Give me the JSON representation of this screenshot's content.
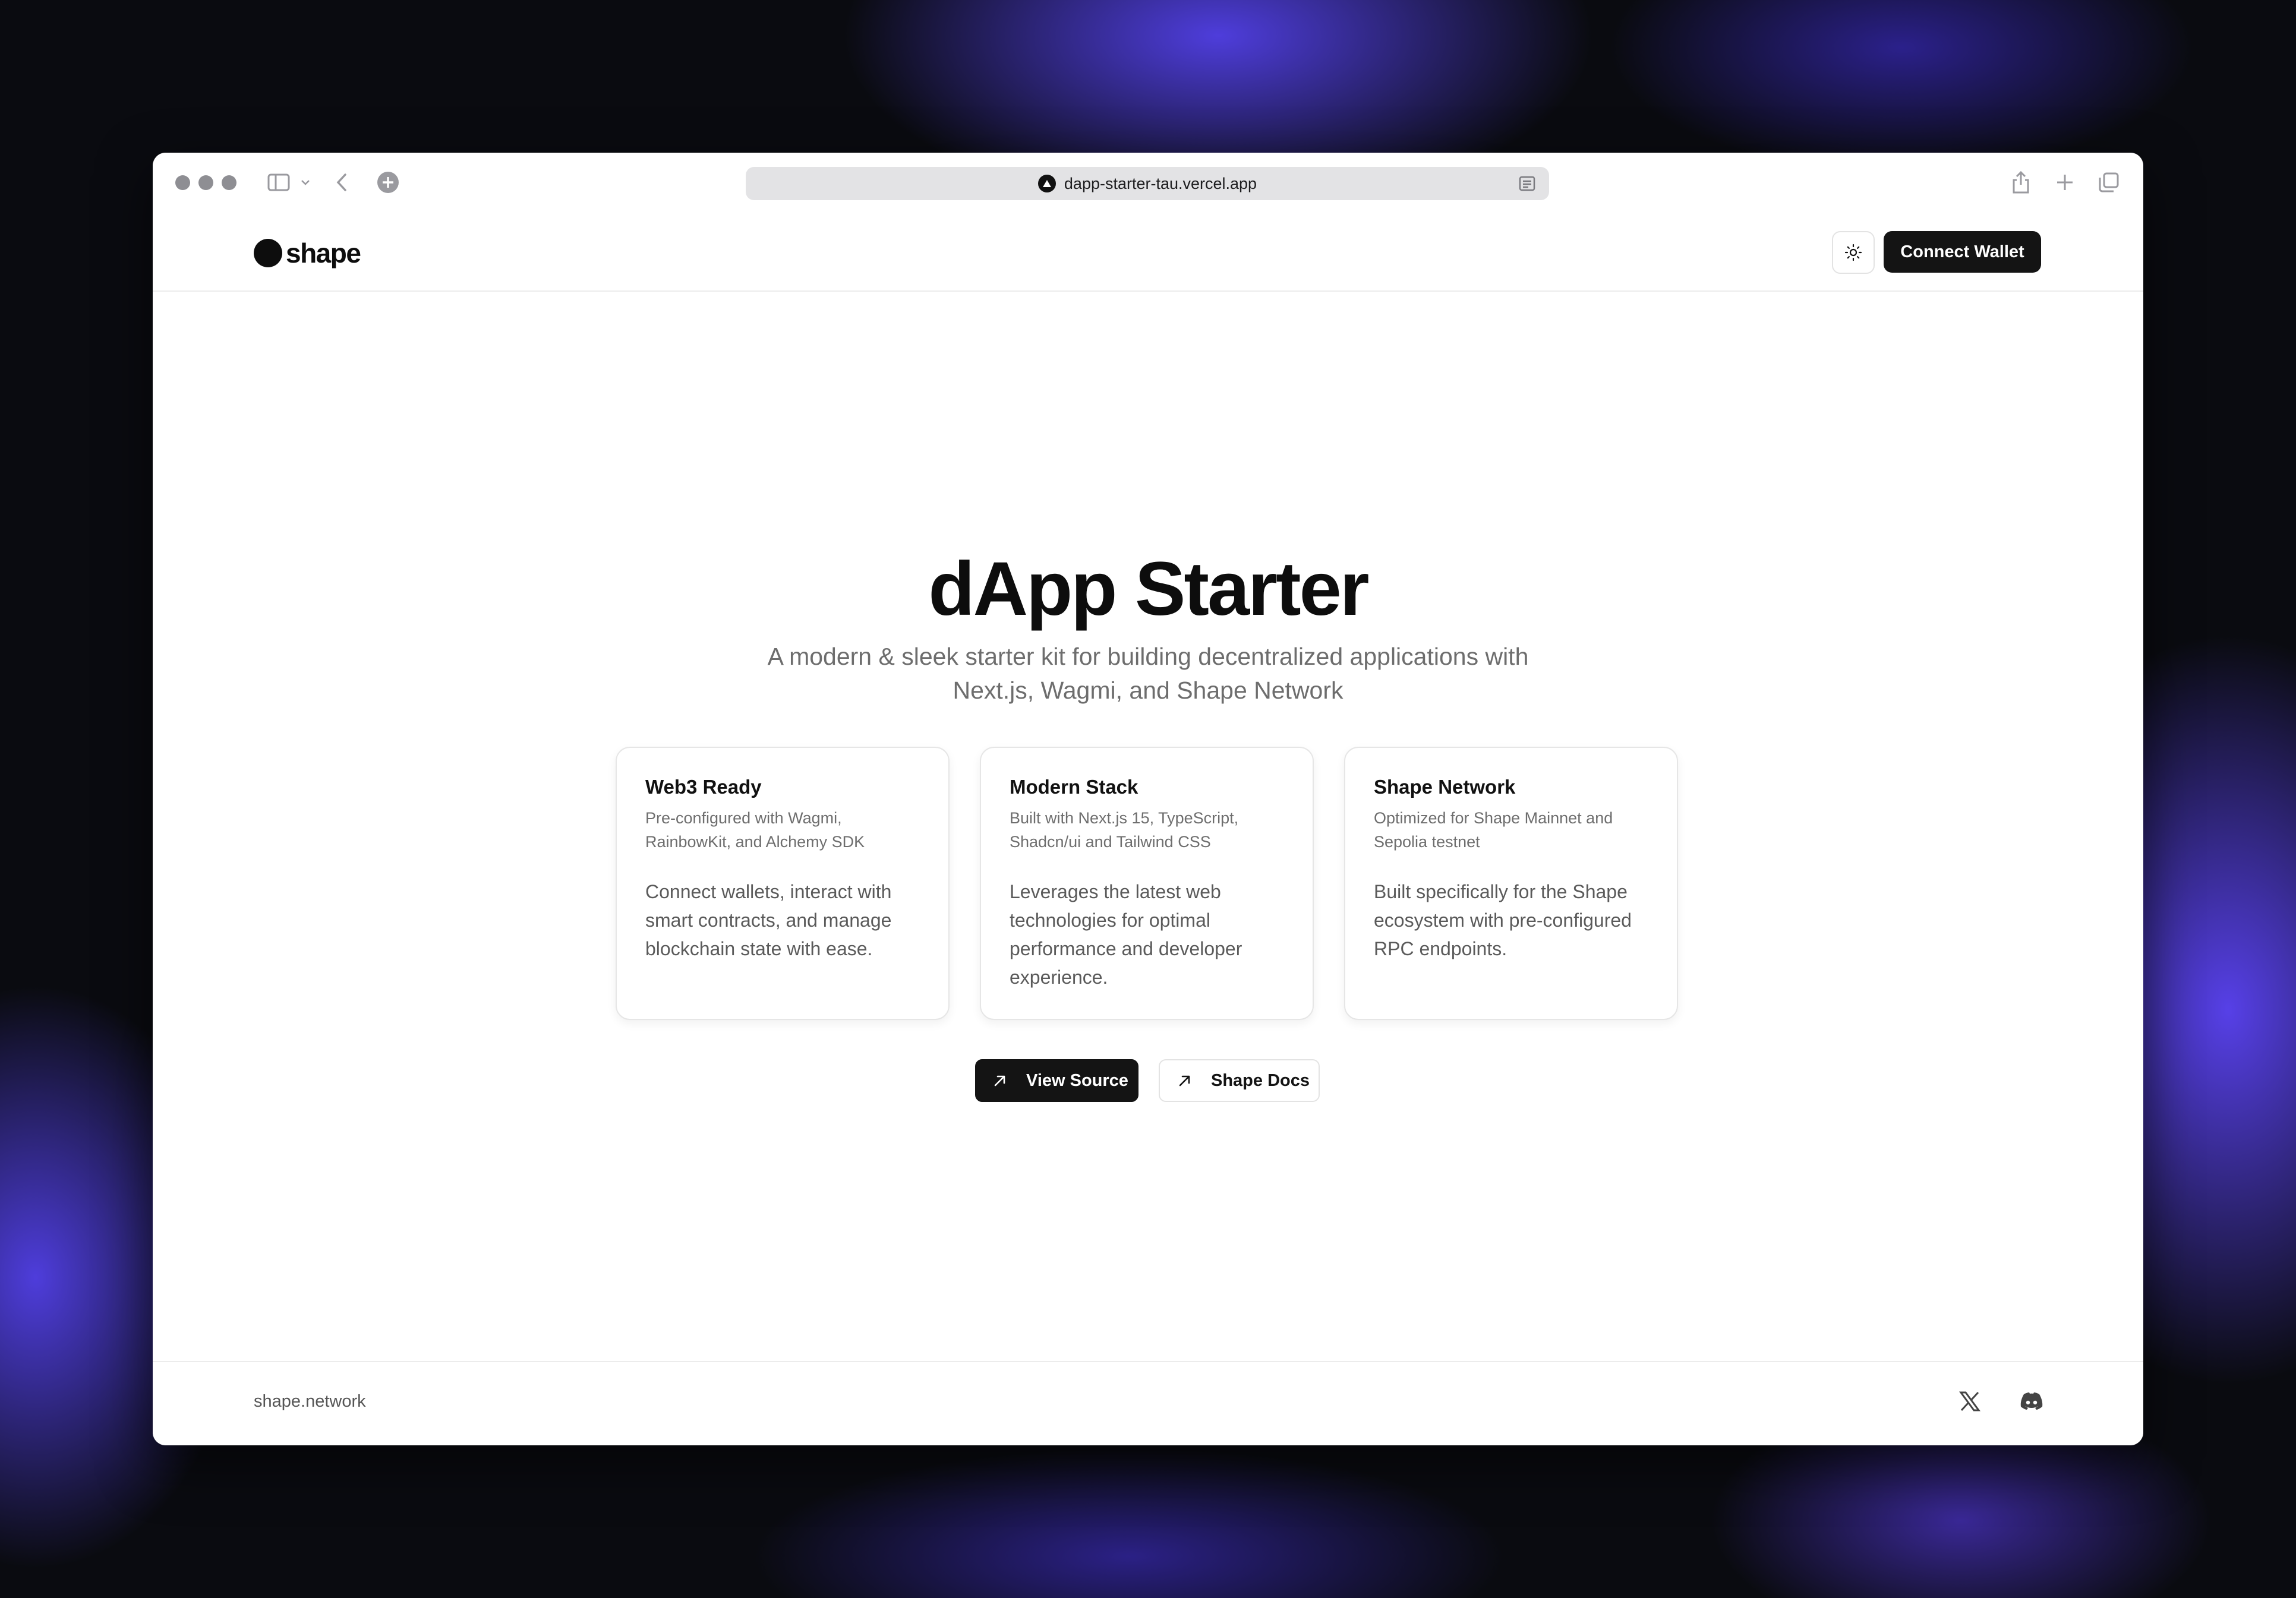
{
  "browser": {
    "url": "dapp-starter-tau.vercel.app"
  },
  "header": {
    "logo_text": "shape",
    "theme_toggle_icon": "sun-icon",
    "connect_label": "Connect Wallet"
  },
  "hero": {
    "title": "dApp Starter",
    "subtitle": "A modern & sleek starter kit for building decentralized applications with Next.js, Wagmi, and Shape Network"
  },
  "cards": [
    {
      "title": "Web3 Ready",
      "description": "Pre-configured with Wagmi, RainbowKit, and Alchemy SDK",
      "body": "Connect wallets, interact with smart contracts, and manage blockchain state with ease."
    },
    {
      "title": "Modern Stack",
      "description": "Built with Next.js 15, TypeScript, Shadcn/ui and Tailwind CSS",
      "body": "Leverages the latest web technologies for optimal performance and developer experience."
    },
    {
      "title": "Shape Network",
      "description": "Optimized for Shape Mainnet and Sepolia testnet",
      "body": "Built specifically for the Shape ecosystem with pre-configured RPC endpoints."
    }
  ],
  "actions": {
    "view_source": "View Source",
    "shape_docs": "Shape Docs"
  },
  "footer": {
    "link": "shape.network",
    "social_icons": [
      "x-icon",
      "discord-icon"
    ]
  },
  "colors": {
    "primary_button": "#141414",
    "accent_wallpaper": "#5a46ff"
  }
}
